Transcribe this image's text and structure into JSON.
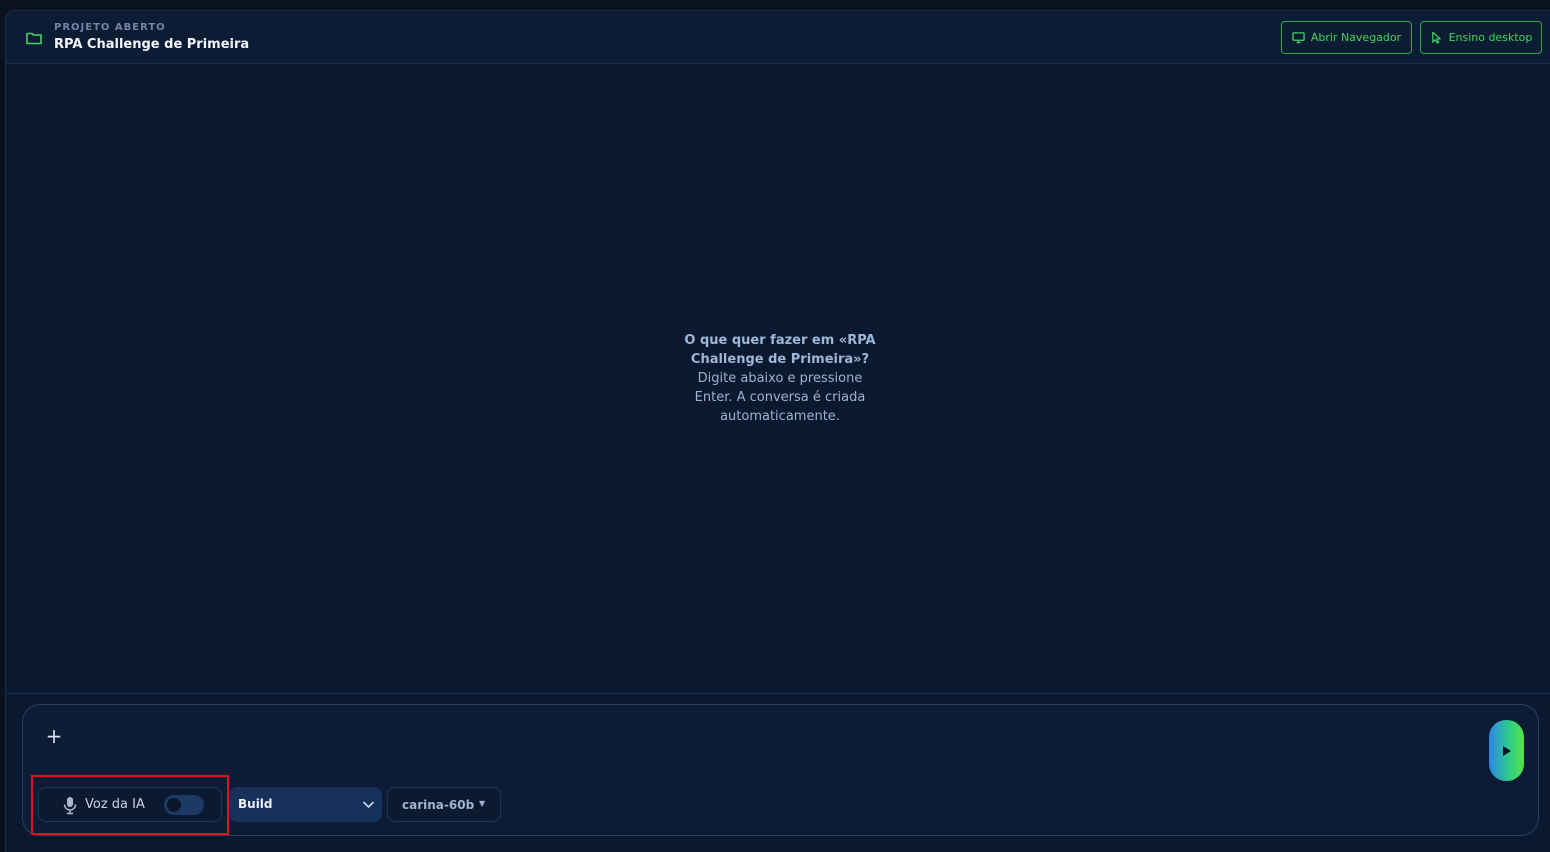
{
  "header": {
    "eyebrow": "PROJETO ABERTO",
    "project_name": "RPA Challenge de Primeira",
    "buttons": {
      "open_browser": "Abrir Navegador",
      "desktop_teaching": "Ensino desktop"
    }
  },
  "empty_state": {
    "question": "O que quer fazer em «RPA Challenge de Primeira»?",
    "hint": "Digite abaixo e pressione Enter. A conversa é criada automaticamente."
  },
  "composer": {
    "add_label": "+",
    "input_value": "",
    "input_placeholder": "",
    "voice_label": "Voz da IA",
    "voice_enabled": false,
    "mode": "Build",
    "model": "carina-60b"
  },
  "colors": {
    "accent_green": "#42d35f",
    "highlight_red": "#e0131b",
    "background": "#0b1930"
  }
}
